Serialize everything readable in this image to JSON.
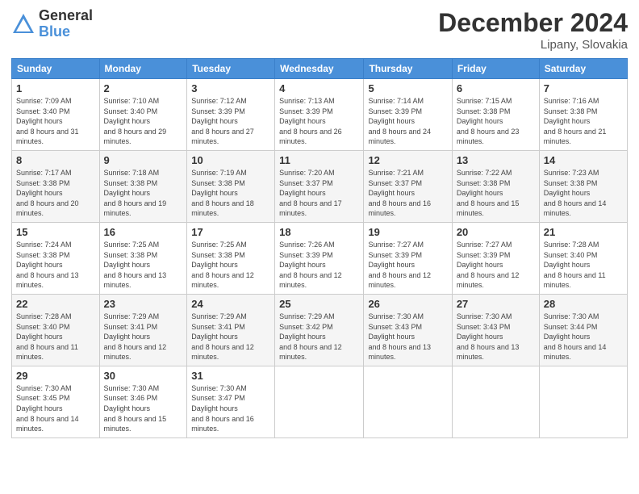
{
  "header": {
    "logo_general": "General",
    "logo_blue": "Blue",
    "title": "December 2024",
    "location": "Lipany, Slovakia"
  },
  "days_of_week": [
    "Sunday",
    "Monday",
    "Tuesday",
    "Wednesday",
    "Thursday",
    "Friday",
    "Saturday"
  ],
  "weeks": [
    [
      {
        "day": "1",
        "sunrise": "7:09 AM",
        "sunset": "3:40 PM",
        "daylight": "8 hours and 31 minutes."
      },
      {
        "day": "2",
        "sunrise": "7:10 AM",
        "sunset": "3:40 PM",
        "daylight": "8 hours and 29 minutes."
      },
      {
        "day": "3",
        "sunrise": "7:12 AM",
        "sunset": "3:39 PM",
        "daylight": "8 hours and 27 minutes."
      },
      {
        "day": "4",
        "sunrise": "7:13 AM",
        "sunset": "3:39 PM",
        "daylight": "8 hours and 26 minutes."
      },
      {
        "day": "5",
        "sunrise": "7:14 AM",
        "sunset": "3:39 PM",
        "daylight": "8 hours and 24 minutes."
      },
      {
        "day": "6",
        "sunrise": "7:15 AM",
        "sunset": "3:38 PM",
        "daylight": "8 hours and 23 minutes."
      },
      {
        "day": "7",
        "sunrise": "7:16 AM",
        "sunset": "3:38 PM",
        "daylight": "8 hours and 21 minutes."
      }
    ],
    [
      {
        "day": "8",
        "sunrise": "7:17 AM",
        "sunset": "3:38 PM",
        "daylight": "8 hours and 20 minutes."
      },
      {
        "day": "9",
        "sunrise": "7:18 AM",
        "sunset": "3:38 PM",
        "daylight": "8 hours and 19 minutes."
      },
      {
        "day": "10",
        "sunrise": "7:19 AM",
        "sunset": "3:38 PM",
        "daylight": "8 hours and 18 minutes."
      },
      {
        "day": "11",
        "sunrise": "7:20 AM",
        "sunset": "3:37 PM",
        "daylight": "8 hours and 17 minutes."
      },
      {
        "day": "12",
        "sunrise": "7:21 AM",
        "sunset": "3:37 PM",
        "daylight": "8 hours and 16 minutes."
      },
      {
        "day": "13",
        "sunrise": "7:22 AM",
        "sunset": "3:38 PM",
        "daylight": "8 hours and 15 minutes."
      },
      {
        "day": "14",
        "sunrise": "7:23 AM",
        "sunset": "3:38 PM",
        "daylight": "8 hours and 14 minutes."
      }
    ],
    [
      {
        "day": "15",
        "sunrise": "7:24 AM",
        "sunset": "3:38 PM",
        "daylight": "8 hours and 13 minutes."
      },
      {
        "day": "16",
        "sunrise": "7:25 AM",
        "sunset": "3:38 PM",
        "daylight": "8 hours and 13 minutes."
      },
      {
        "day": "17",
        "sunrise": "7:25 AM",
        "sunset": "3:38 PM",
        "daylight": "8 hours and 12 minutes."
      },
      {
        "day": "18",
        "sunrise": "7:26 AM",
        "sunset": "3:39 PM",
        "daylight": "8 hours and 12 minutes."
      },
      {
        "day": "19",
        "sunrise": "7:27 AM",
        "sunset": "3:39 PM",
        "daylight": "8 hours and 12 minutes."
      },
      {
        "day": "20",
        "sunrise": "7:27 AM",
        "sunset": "3:39 PM",
        "daylight": "8 hours and 12 minutes."
      },
      {
        "day": "21",
        "sunrise": "7:28 AM",
        "sunset": "3:40 PM",
        "daylight": "8 hours and 11 minutes."
      }
    ],
    [
      {
        "day": "22",
        "sunrise": "7:28 AM",
        "sunset": "3:40 PM",
        "daylight": "8 hours and 11 minutes."
      },
      {
        "day": "23",
        "sunrise": "7:29 AM",
        "sunset": "3:41 PM",
        "daylight": "8 hours and 12 minutes."
      },
      {
        "day": "24",
        "sunrise": "7:29 AM",
        "sunset": "3:41 PM",
        "daylight": "8 hours and 12 minutes."
      },
      {
        "day": "25",
        "sunrise": "7:29 AM",
        "sunset": "3:42 PM",
        "daylight": "8 hours and 12 minutes."
      },
      {
        "day": "26",
        "sunrise": "7:30 AM",
        "sunset": "3:43 PM",
        "daylight": "8 hours and 13 minutes."
      },
      {
        "day": "27",
        "sunrise": "7:30 AM",
        "sunset": "3:43 PM",
        "daylight": "8 hours and 13 minutes."
      },
      {
        "day": "28",
        "sunrise": "7:30 AM",
        "sunset": "3:44 PM",
        "daylight": "8 hours and 14 minutes."
      }
    ],
    [
      {
        "day": "29",
        "sunrise": "7:30 AM",
        "sunset": "3:45 PM",
        "daylight": "8 hours and 14 minutes."
      },
      {
        "day": "30",
        "sunrise": "7:30 AM",
        "sunset": "3:46 PM",
        "daylight": "8 hours and 15 minutes."
      },
      {
        "day": "31",
        "sunrise": "7:30 AM",
        "sunset": "3:47 PM",
        "daylight": "8 hours and 16 minutes."
      },
      null,
      null,
      null,
      null
    ]
  ]
}
